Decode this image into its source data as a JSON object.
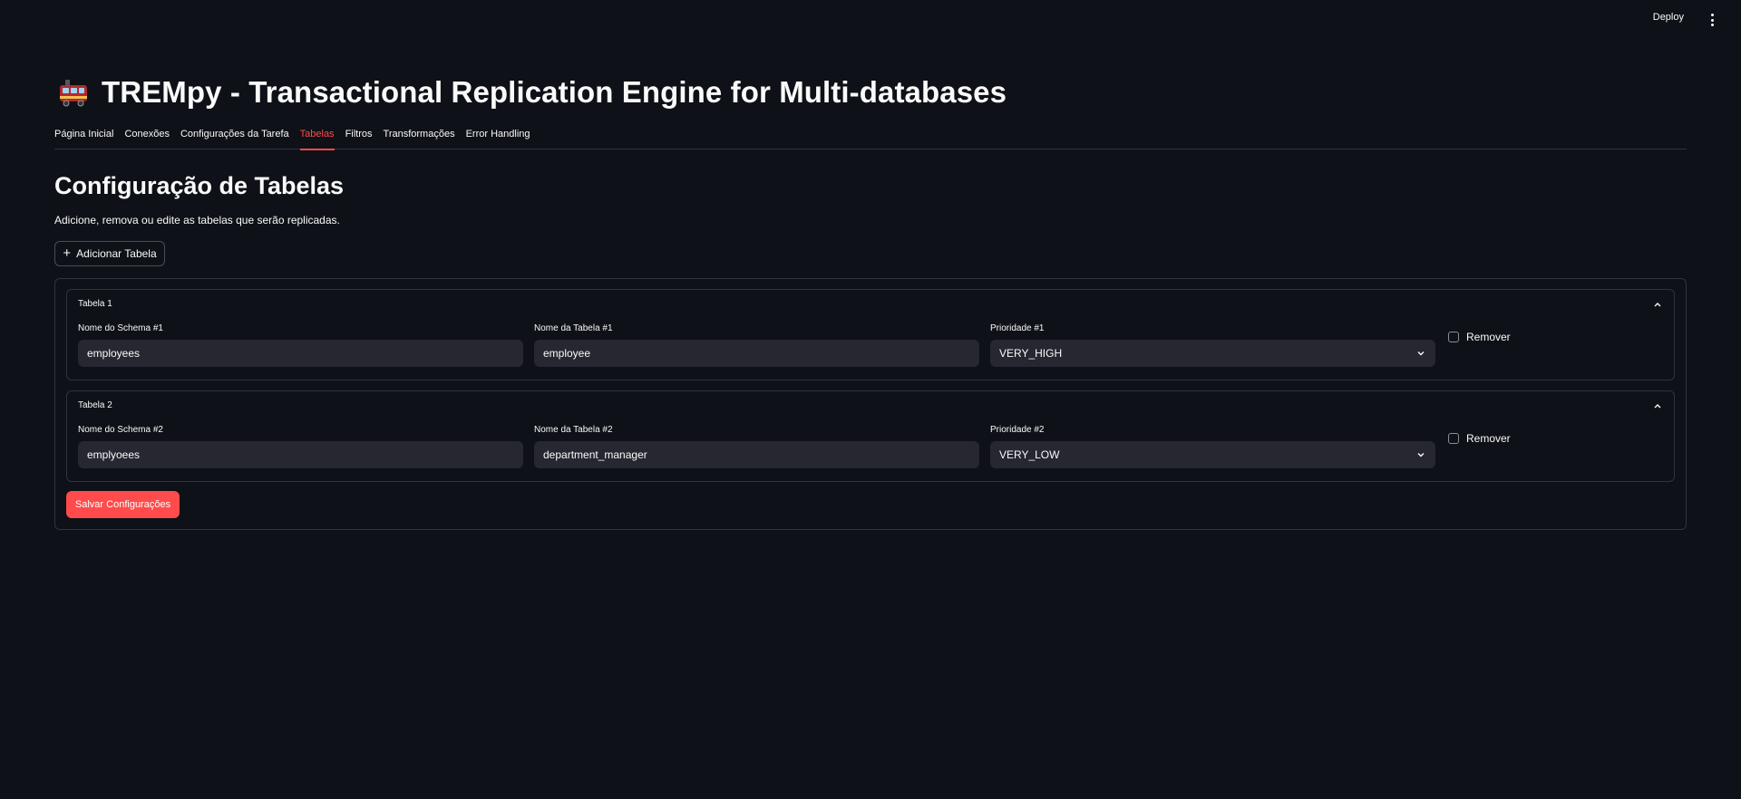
{
  "header": {
    "deploy_label": "Deploy",
    "menu_icon": "kebab-menu-icon"
  },
  "app": {
    "title": "TREMpy - Transactional Replication Engine for Multi-databases",
    "title_icon": "train-icon"
  },
  "tabs": [
    {
      "label": "Página Inicial",
      "active": false
    },
    {
      "label": "Conexões",
      "active": false
    },
    {
      "label": "Configurações da Tarefa",
      "active": false
    },
    {
      "label": "Tabelas",
      "active": true
    },
    {
      "label": "Filtros",
      "active": false
    },
    {
      "label": "Transformações",
      "active": false
    },
    {
      "label": "Error Handling",
      "active": false
    }
  ],
  "page": {
    "heading": "Configuração de Tabelas",
    "description": "Adicione, remova ou edite as tabelas que serão replicadas.",
    "add_button": "Adicionar Tabela",
    "save_button": "Salvar Configurações"
  },
  "tables": [
    {
      "title": "Tabela 1",
      "schema_label": "Nome do Schema #1",
      "schema_value": "employees",
      "table_label": "Nome da Tabela #1",
      "table_value": "employee",
      "priority_label": "Prioridade #1",
      "priority_value": "VERY_HIGH",
      "remove_label": "Remover"
    },
    {
      "title": "Tabela 2",
      "schema_label": "Nome do Schema #2",
      "schema_value": "emplyoees",
      "table_label": "Nome da Tabela #2",
      "table_value": "department_manager",
      "priority_label": "Prioridade #2",
      "priority_value": "VERY_LOW",
      "remove_label": "Remover"
    }
  ],
  "colors": {
    "background": "#0e1117",
    "accent": "#ff4b4b",
    "input_bg": "#262730",
    "border": "#31333f"
  }
}
